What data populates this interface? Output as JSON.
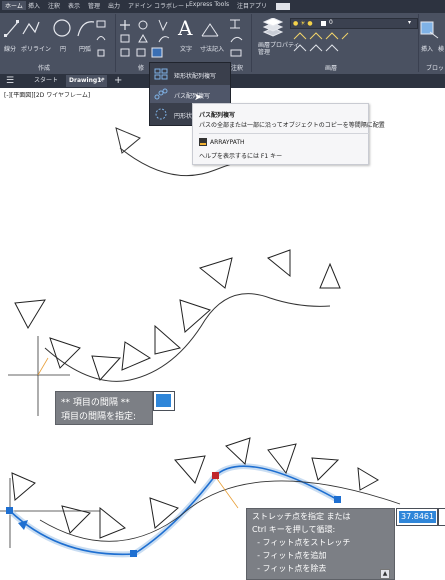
{
  "menu": {
    "tabs": [
      "ホーム",
      "挿入",
      "注釈",
      "表示",
      "管理",
      "出力",
      "アドイン",
      "コラボレート",
      "Express Tools",
      "注目アプリ"
    ],
    "active_tab": "ホーム"
  },
  "ribbon": {
    "draw": {
      "line": "線分",
      "polyline": "ポリライン",
      "circle": "円",
      "arc": "円弧",
      "panel": "作成"
    },
    "modify_panel": "修",
    "annotation": {
      "text": "文字",
      "dimension": "寸法記入",
      "panel_suffix": "注釈"
    },
    "layers": {
      "properties": "画層プロパティ\n管理",
      "panel": "画層",
      "layer_value": "0"
    },
    "insert": {
      "label": "挿入",
      "extra": "検"
    },
    "block_panel": "ブロッ"
  },
  "doc_tabs": {
    "start": "スタート",
    "drawing": "Drawing1*",
    "close": "×",
    "add": "+"
  },
  "viewport_label": "[-][平面図][2D ワイヤフレーム]",
  "flyout": {
    "items": [
      {
        "label": "矩形状配列複写"
      },
      {
        "label": "パス配列複写"
      },
      {
        "label": "円形状配"
      }
    ]
  },
  "tooltip": {
    "title": "パス配列複写",
    "description": "パスの全部または一部に沿ってオブジェクトのコピーを等間隔に配置",
    "command": "ARRAYPATH",
    "help": "ヘルプを表示するには F1 キー"
  },
  "prompt1": {
    "line1": "** 項目の間隔 **",
    "line2": "項目の間隔を指定:"
  },
  "prompt2": {
    "lines": [
      "ストレッチ点を指定 または",
      "Ctrl キーを押して循環:",
      "  - フィット点をストレッチ",
      "  - フィット点を追加",
      "  - フィット点を除去"
    ],
    "value": "37.8461",
    "scroll_icon": "▲"
  },
  "colors": {
    "ribbon_bg": "#4a5161",
    "menubar_bg": "#2d3340",
    "grip_blue": "#1e6fd1",
    "grip_red": "#c0272d",
    "path_highlight": "#2f86d9",
    "prompt_bg": "#7c7f85"
  }
}
